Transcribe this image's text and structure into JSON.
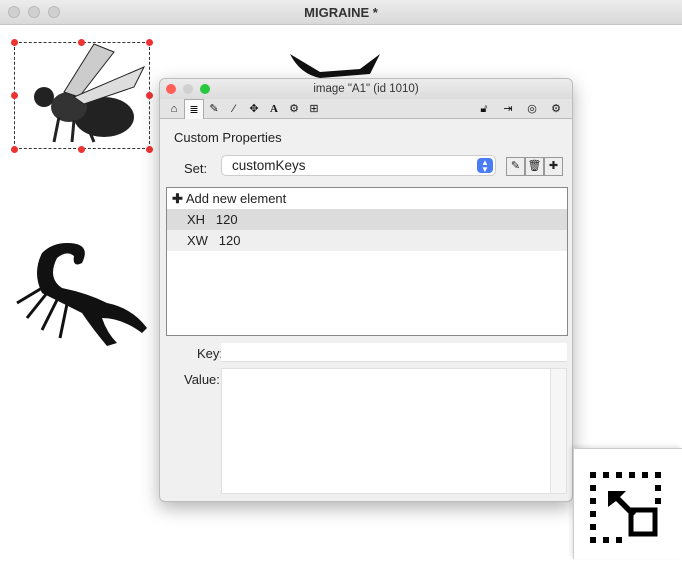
{
  "window": {
    "title": "MIGRAINE *"
  },
  "palette": {
    "title": "image \"A1\" (id 1010)",
    "toolbar_left": [
      "home-icon",
      "database-icon",
      "pencil-icon",
      "wand-icon",
      "move-icon",
      "text-icon",
      "gears-icon",
      "table-icon"
    ],
    "toolbar_right": [
      "lock-open-icon",
      "exit-icon",
      "target-icon",
      "gear-icon"
    ],
    "heading": "Custom Properties",
    "set_label": "Set:",
    "set_value": "customKeys",
    "add_label": "Add new element",
    "rows": [
      {
        "key": "XH",
        "value": "120"
      },
      {
        "key": "XW",
        "value": "120"
      }
    ],
    "key_label": "Key:",
    "value_label": "Value:",
    "key_value": "",
    "value_value": ""
  },
  "colors": {
    "close": "#fe5f57",
    "minimize": "#febc2e",
    "zoom": "#28c840",
    "accent": "#4a7cf5"
  }
}
